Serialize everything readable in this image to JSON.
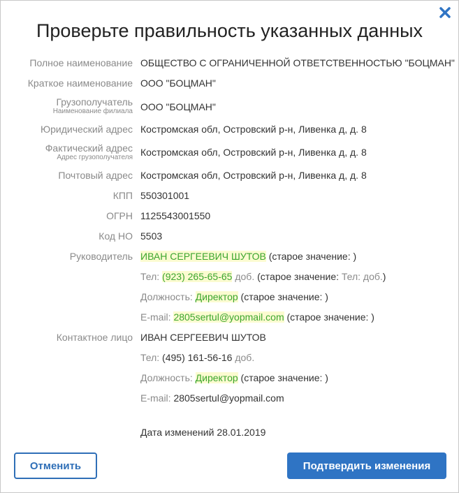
{
  "dialog": {
    "title": "Проверьте правильность указанных данных",
    "close_icon": "close-icon"
  },
  "fields": {
    "full_name": {
      "label": "Полное наименование",
      "value": "ОБЩЕСТВО С ОГРАНИЧЕННОЙ ОТВЕТСТВЕННОСТЬЮ \"БОЦМАН\""
    },
    "short_name": {
      "label": "Краткое наименование",
      "value": "ООО \"БОЦМАН\""
    },
    "consignee": {
      "label": "Грузополучатель",
      "sublabel": "Наименование филиала",
      "value": "ООО \"БОЦМАН\""
    },
    "legal_address": {
      "label": "Юридический адрес",
      "value": "Костромская обл, Островский р-н, Ливенка д, д. 8"
    },
    "actual_address": {
      "label": "Фактический адрес",
      "sublabel": "Адрес грузополучателя",
      "value": "Костромская обл, Островский р-н, Ливенка д, д. 8"
    },
    "postal_address": {
      "label": "Почтовый адрес",
      "value": "Костромская обл, Островский р-н, Ливенка д, д. 8"
    },
    "kpp": {
      "label": "КПП",
      "value": "550301001"
    },
    "ogrn": {
      "label": "ОГРН",
      "value": "1125543001550"
    },
    "code_no": {
      "label": "Код НО",
      "value": "5503"
    }
  },
  "manager": {
    "label": "Руководитель",
    "name": "ИВАН СЕРГЕЕВИЧ ШУТОВ",
    "name_old": "(старое значение: )",
    "phone_label": "Тел:",
    "phone": "(923) 265-65-65",
    "ext_label": "доб.",
    "phone_old_prefix": "(старое значение:",
    "phone_old_value": "Тел: доб.",
    "phone_old_suffix": ")",
    "position_label": "Должность:",
    "position": "Директор",
    "position_old": "(старое значение: )",
    "email_label": "E-mail:",
    "email": "2805sertul@yopmail.com",
    "email_old": "(старое значение: )"
  },
  "contact": {
    "label": "Контактное лицо",
    "name": "ИВАН СЕРГЕЕВИЧ ШУТОВ",
    "phone_label": "Тел:",
    "phone": "(495) 161-56-16",
    "ext_label": "доб.",
    "position_label": "Должность:",
    "position": "Директор",
    "position_old": "(старое значение: )",
    "email_label": "E-mail:",
    "email": "2805sertul@yopmail.com"
  },
  "change_date": "Дата изменений 28.01.2019",
  "buttons": {
    "cancel": "Отменить",
    "confirm": "Подтвердить изменения"
  },
  "colors": {
    "accent": "#2f74c4",
    "changed_text": "#3ca62e",
    "changed_background": "#fbfbd0"
  }
}
